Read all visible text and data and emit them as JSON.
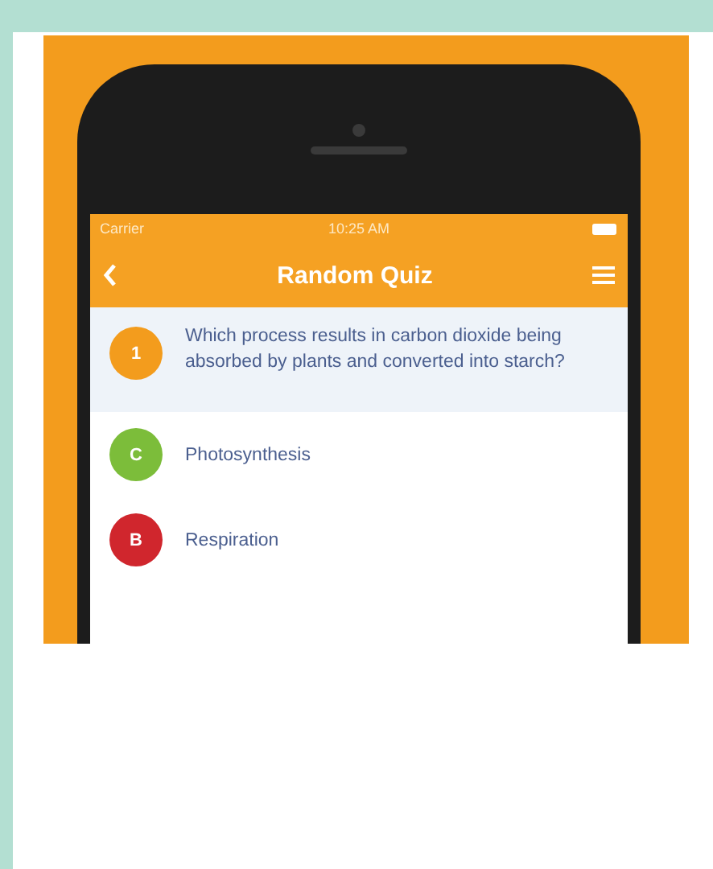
{
  "status_bar": {
    "carrier": "Carrier",
    "time": "10:25 AM"
  },
  "nav_bar": {
    "title": "Random Quiz"
  },
  "question": {
    "number": "1",
    "text": "Which process results in carbon dioxide being absorbed by plants and converted into starch?"
  },
  "answers": [
    {
      "letter": "C",
      "text": "Photosynthesis",
      "color": "#7cbd3a"
    },
    {
      "letter": "B",
      "text": "Respiration",
      "color": "#d0262d"
    }
  ]
}
